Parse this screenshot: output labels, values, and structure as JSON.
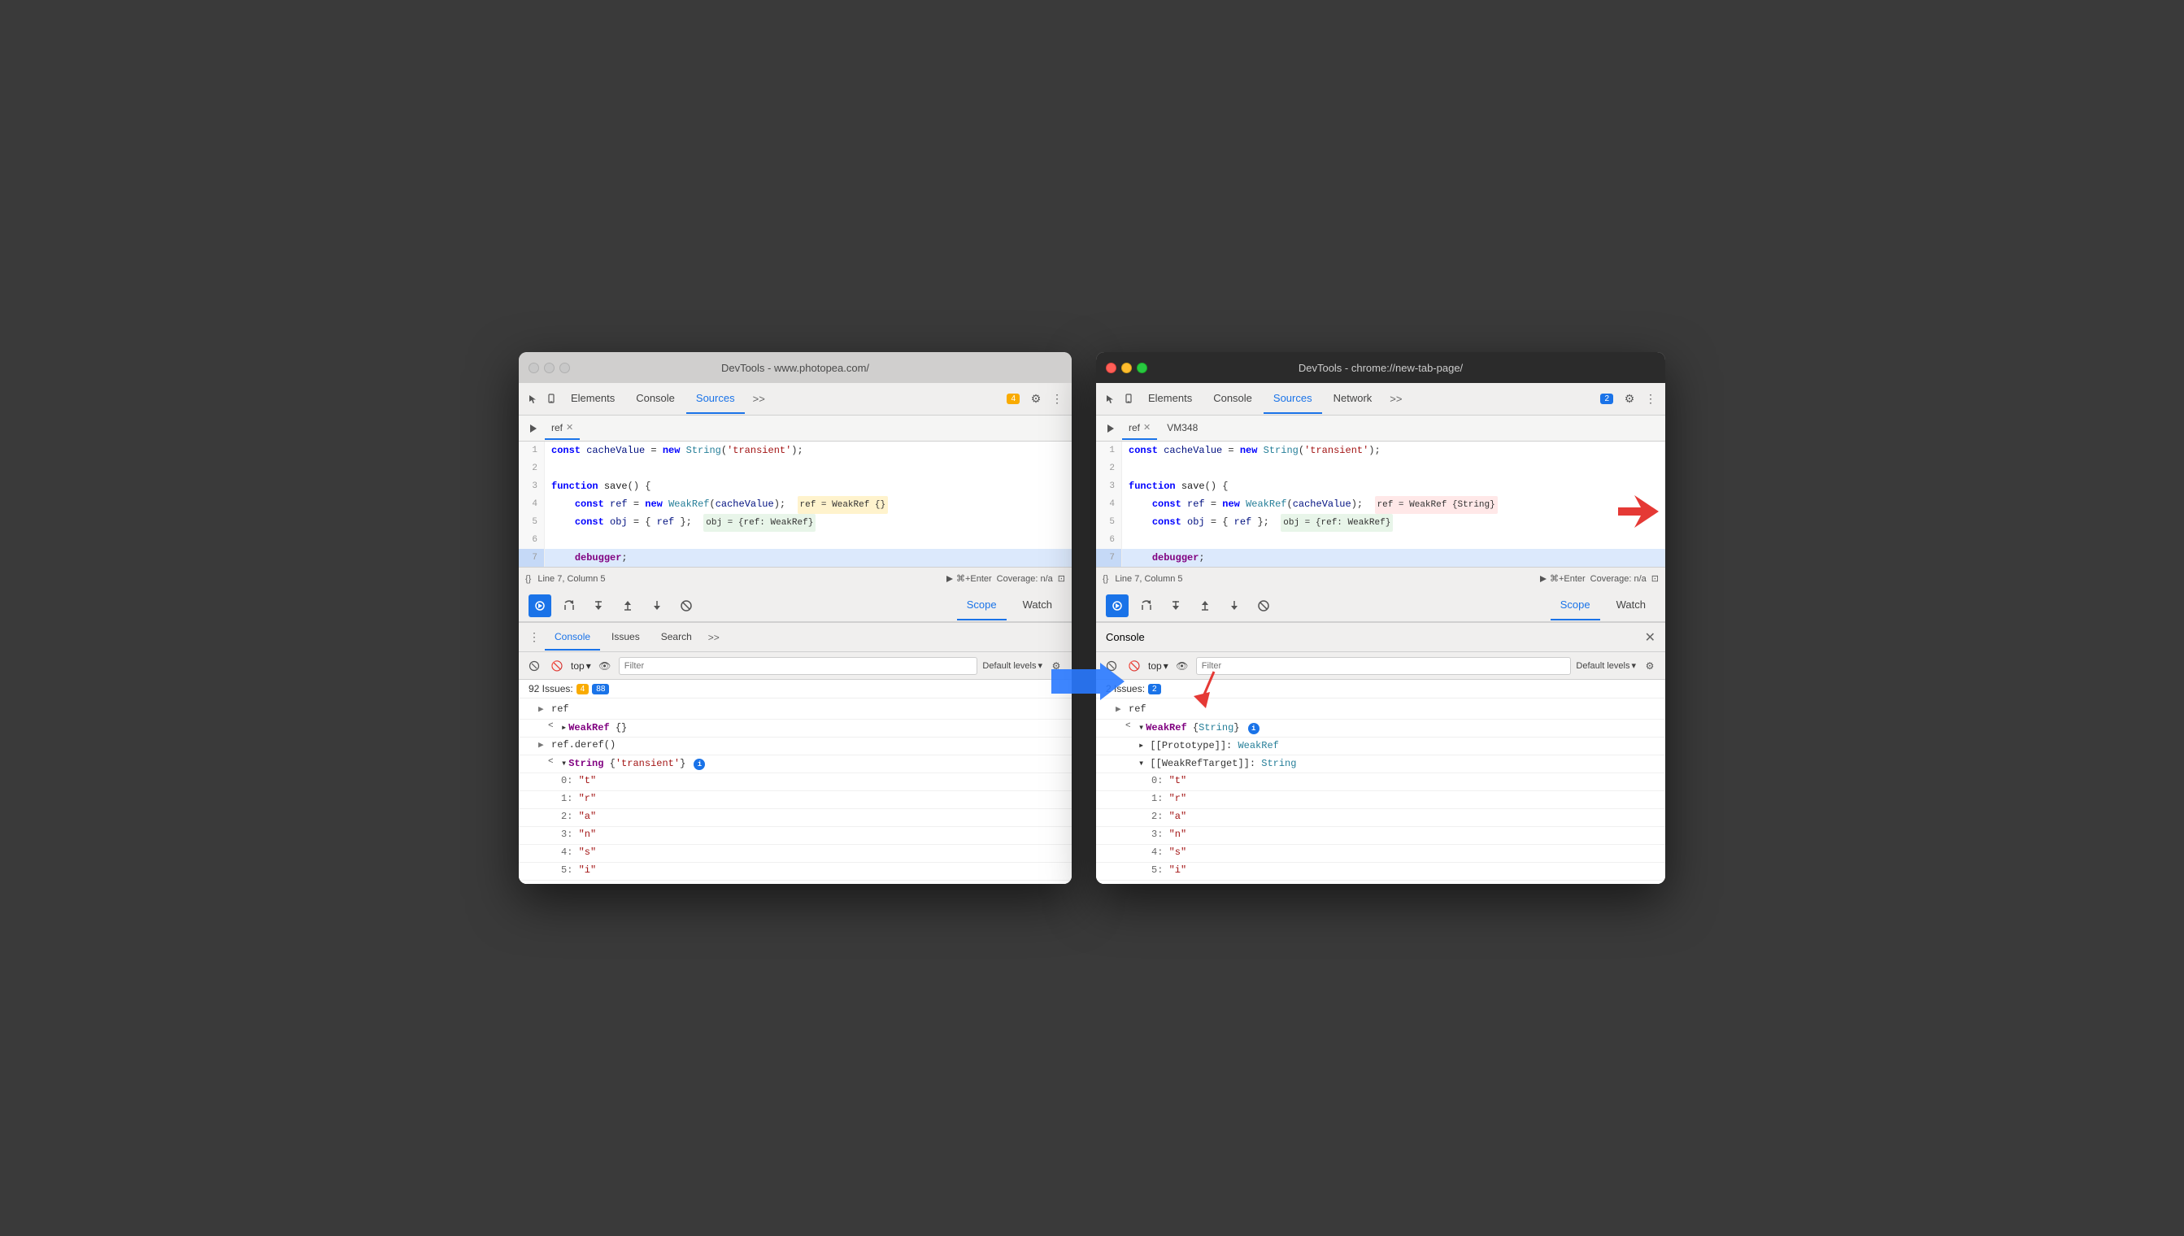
{
  "window1": {
    "title": "DevTools - www.photopea.com/",
    "tabs": [
      "Elements",
      "Console",
      "Sources",
      ">>"
    ],
    "active_tab": "Sources",
    "badge": "4",
    "file_tabs": [
      "ref",
      ""
    ],
    "code_lines": [
      {
        "num": 1,
        "content": "const cacheValue = new String('transient');"
      },
      {
        "num": 2,
        "content": ""
      },
      {
        "num": 3,
        "content": "function save() {"
      },
      {
        "num": 4,
        "content": "    const ref = new WeakRef(cacheValue);",
        "tag": "ref = WeakRef {}"
      },
      {
        "num": 5,
        "content": "    const obj = { ref };",
        "tag": "obj = {ref: WeakRef}"
      },
      {
        "num": 6,
        "content": ""
      },
      {
        "num": 7,
        "content": "    debugger;",
        "highlight": true
      }
    ],
    "status": "Line 7, Column 5",
    "coverage": "Coverage: n/a",
    "debug_tabs": [
      "Scope",
      "Watch"
    ],
    "active_debug_tab": "Scope",
    "bottom_tabs": [
      "Console",
      "Issues",
      "Search"
    ],
    "active_bottom_tab": "Console",
    "console_top": "top",
    "console_filter": "Filter",
    "console_levels": "Default levels",
    "issues_count": "92 Issues:",
    "issues_warn": "4",
    "issues_info": "88",
    "console_entries": [
      {
        "type": "ref",
        "text": "ref"
      },
      {
        "type": "weakref",
        "indent": 1,
        "text": "▶ WeakRef {}"
      },
      {
        "type": "deref",
        "text": "ref.deref()"
      },
      {
        "type": "string",
        "indent": 1,
        "text": "▼ String {'transient'}",
        "info": true
      },
      {
        "type": "str_val",
        "indent": 2,
        "key": "0:",
        "val": "\"t\""
      },
      {
        "type": "str_val",
        "indent": 2,
        "key": "1:",
        "val": "\"r\""
      },
      {
        "type": "str_val",
        "indent": 2,
        "key": "2:",
        "val": "\"a\""
      },
      {
        "type": "str_val",
        "indent": 2,
        "key": "3:",
        "val": "\"n\""
      },
      {
        "type": "str_val",
        "indent": 2,
        "key": "4:",
        "val": "\"s\""
      },
      {
        "type": "str_val",
        "indent": 2,
        "key": "5:",
        "val": "\"i\""
      }
    ]
  },
  "window2": {
    "title": "DevTools - chrome://new-tab-page/",
    "tabs": [
      "Elements",
      "Console",
      "Sources",
      "Network",
      ">>"
    ],
    "active_tab": "Sources",
    "badge": "2",
    "file_tabs": [
      "ref",
      "VM348"
    ],
    "code_lines": [
      {
        "num": 1,
        "content": "const cacheValue = new String('transient');"
      },
      {
        "num": 2,
        "content": ""
      },
      {
        "num": 3,
        "content": "function save() {"
      },
      {
        "num": 4,
        "content": "    const ref = new WeakRef(cacheValue);",
        "tag": "ref = WeakRef {String}"
      },
      {
        "num": 5,
        "content": "    const obj = { ref };",
        "tag": "obj = {ref: WeakRef}"
      },
      {
        "num": 6,
        "content": ""
      },
      {
        "num": 7,
        "content": "    debugger;",
        "highlight": true
      }
    ],
    "status": "Line 7, Column 5",
    "coverage": "Coverage: n/a",
    "debug_tabs": [
      "Scope",
      "Watch"
    ],
    "active_debug_tab": "Scope",
    "console_header": "Console",
    "console_top": "top",
    "console_filter": "Filter",
    "console_levels": "Default levels",
    "issues_count": "2 Issues:",
    "issues_info": "2",
    "console_entries": [
      {
        "type": "ref",
        "text": "ref"
      },
      {
        "type": "weakref_string",
        "indent": 1,
        "text": "▼ WeakRef {String}",
        "info": true
      },
      {
        "type": "proto",
        "indent": 2,
        "text": "▶ [[Prototype]]: WeakRef"
      },
      {
        "type": "target",
        "indent": 2,
        "text": "▼ [[WeakRefTarget]]: String"
      },
      {
        "type": "str_val",
        "indent": 3,
        "key": "0:",
        "val": "\"t\""
      },
      {
        "type": "str_val",
        "indent": 3,
        "key": "1:",
        "val": "\"r\""
      },
      {
        "type": "str_val",
        "indent": 3,
        "key": "2:",
        "val": "\"a\""
      },
      {
        "type": "str_val",
        "indent": 3,
        "key": "3:",
        "val": "\"n\""
      },
      {
        "type": "str_val",
        "indent": 3,
        "key": "4:",
        "val": "\"s\""
      },
      {
        "type": "str_val",
        "indent": 3,
        "key": "5:",
        "val": "\"i\""
      }
    ]
  },
  "labels": {
    "elements": "Elements",
    "console": "Console",
    "sources": "Sources",
    "network": "Network",
    "scope": "Scope",
    "watch": "Watch",
    "issues": "Issues",
    "search": "Search",
    "filter": "Filter",
    "default_levels": "Default levels",
    "coverage": "Coverage: n/a",
    "run": "▶ ⌘+Enter",
    "close": "✕"
  }
}
